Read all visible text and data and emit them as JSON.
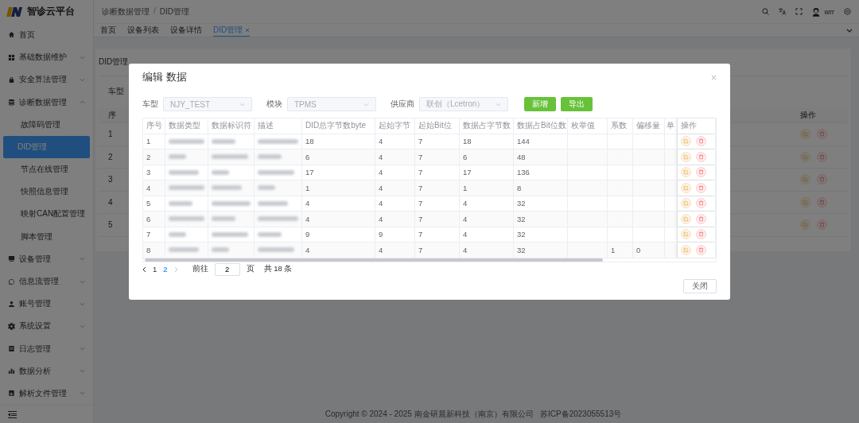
{
  "sidebar": {
    "title": "智诊云平台",
    "items": [
      {
        "label": "首页",
        "kind": "link"
      },
      {
        "label": "基础数据维护",
        "kind": "group",
        "expanded": false
      },
      {
        "label": "安全算法管理",
        "kind": "group",
        "expanded": false
      },
      {
        "label": "诊断数据管理",
        "kind": "group",
        "expanded": true,
        "children": [
          {
            "label": "故障码管理",
            "selected": false
          },
          {
            "label": "DID管理",
            "selected": true
          },
          {
            "label": "节点在线管理",
            "selected": false
          },
          {
            "label": "快照信息管理",
            "selected": false
          },
          {
            "label": "映射CAN配置管理",
            "selected": false
          },
          {
            "label": "脚本管理",
            "selected": false
          }
        ]
      },
      {
        "label": "设备管理",
        "kind": "group",
        "expanded": false
      },
      {
        "label": "信息流管理",
        "kind": "group",
        "expanded": false
      },
      {
        "label": "账号管理",
        "kind": "group",
        "expanded": false
      },
      {
        "label": "系统设置",
        "kind": "group",
        "expanded": false
      },
      {
        "label": "日志管理",
        "kind": "group",
        "expanded": false
      },
      {
        "label": "数据分析",
        "kind": "group",
        "expanded": false
      },
      {
        "label": "解析文件管理",
        "kind": "group",
        "expanded": false
      }
    ]
  },
  "header": {
    "breadcrumb": [
      "诊断数据管理",
      "DID管理"
    ],
    "separator": "/",
    "user": "wrr"
  },
  "tabs": [
    {
      "label": "首页",
      "selected": false
    },
    {
      "label": "设备列表",
      "selected": false
    },
    {
      "label": "设备详情",
      "selected": false
    },
    {
      "label": "DID管理",
      "selected": true
    }
  ],
  "page": {
    "title": "DID管理",
    "filter_label": "车型",
    "table": {
      "first_column": "序",
      "action_column": "操作",
      "rows": [
        "1",
        "2",
        "3",
        "4",
        "5"
      ]
    }
  },
  "dialog": {
    "title": "编辑 数据",
    "filters": [
      {
        "label": "车型",
        "value": "NJY_TEST"
      },
      {
        "label": "模块",
        "value": "TPMS"
      },
      {
        "label": "供应商",
        "value": "联创（Lcetron）"
      }
    ],
    "buttons": [
      "新增",
      "导出"
    ],
    "columns": [
      {
        "label": "序号",
        "kind": "text"
      },
      {
        "label": "数据类型",
        "kind": "blurred"
      },
      {
        "label": "数据标识符",
        "kind": "blurred"
      },
      {
        "label": "描述",
        "kind": "blurred"
      },
      {
        "label": "DID总字节数byte",
        "kind": "text"
      },
      {
        "label": "起始字节",
        "kind": "text"
      },
      {
        "label": "起始Bit位",
        "kind": "text"
      },
      {
        "label": "数据占字节数",
        "kind": "text"
      },
      {
        "label": "数据占Bit位数",
        "kind": "text"
      },
      {
        "label": "枚举值",
        "kind": "text"
      },
      {
        "label": "系数",
        "kind": "text"
      },
      {
        "label": "偏移量",
        "kind": "text"
      },
      {
        "label": "单",
        "kind": "text"
      },
      {
        "label": "操作",
        "kind": "actions"
      }
    ],
    "rows": [
      {
        "cells": [
          "1",
          null,
          null,
          null,
          "18",
          "4",
          "7",
          "18",
          "144"
        ]
      },
      {
        "cells": [
          "2",
          null,
          null,
          null,
          "6",
          "4",
          "7",
          "6",
          "48"
        ]
      },
      {
        "cells": [
          "3",
          null,
          null,
          null,
          "17",
          "4",
          "7",
          "17",
          "136"
        ]
      },
      {
        "cells": [
          "4",
          null,
          null,
          null,
          "1",
          "4",
          "7",
          "1",
          "8"
        ]
      },
      {
        "cells": [
          "5",
          null,
          null,
          null,
          "4",
          "4",
          "7",
          "4",
          "32"
        ]
      },
      {
        "cells": [
          "6",
          null,
          null,
          null,
          "4",
          "4",
          "7",
          "4",
          "32"
        ]
      },
      {
        "cells": [
          "7",
          null,
          null,
          null,
          "9",
          "9",
          "7",
          "4",
          "32"
        ]
      },
      {
        "cells": [
          "8",
          null,
          null,
          null,
          "4",
          "4",
          "7",
          "4",
          "32",
          null,
          "1",
          "0"
        ]
      }
    ],
    "pagination": {
      "prev_disabled": false,
      "next_disabled": true,
      "pages": [
        {
          "label": "1",
          "selected": false
        },
        {
          "label": "2",
          "selected": true
        }
      ],
      "goto_label": "前往",
      "goto_value": "2",
      "page_unit": "页",
      "total": "共 18 条"
    },
    "close_button": "关闭"
  },
  "footer": "Copyright © 2024 - 2025 南金研晨新科技（南京）有限公司   苏ICP备2023055513号"
}
